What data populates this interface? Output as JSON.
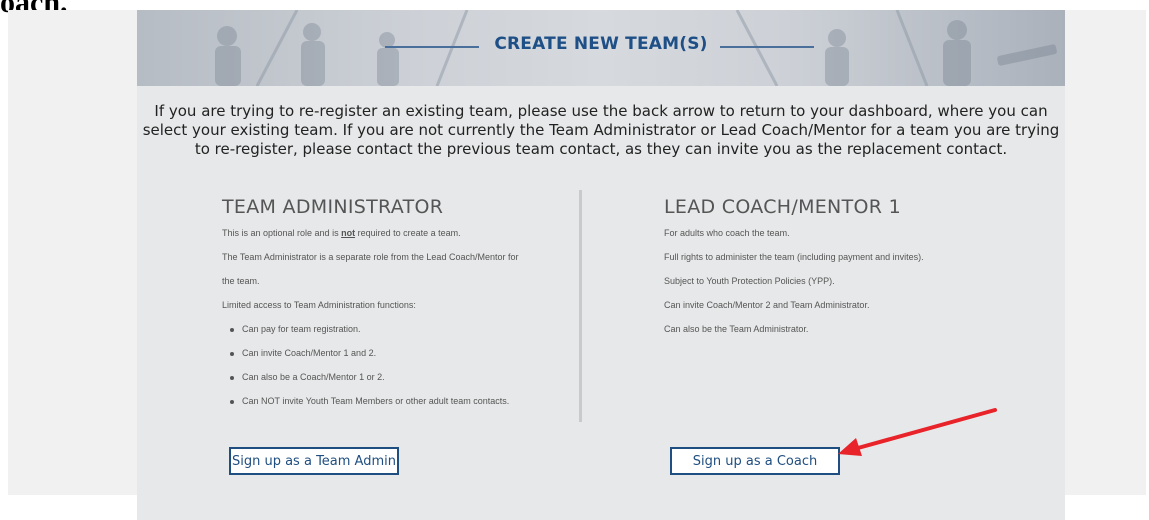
{
  "caption_fragment": "oach.",
  "banner": {
    "title": "CREATE NEW TEAM(S)"
  },
  "intro": {
    "lines": [
      "If you are trying to re-register an existing team, please use the back arrow to return to your dashboard, where you can",
      "select your existing team. If you are not currently the Team Administrator or Lead Coach/Mentor for a team you are trying",
      "to re-register, please contact the previous team contact, as they can invite you as the replacement contact."
    ]
  },
  "admin": {
    "heading": "TEAM ADMINISTRATOR",
    "optional_prefix": "This is an optional role and is ",
    "optional_emphasis": "not",
    "optional_suffix": " required to create a team.",
    "desc_line1": "The Team Administrator is a separate role from the Lead Coach/Mentor for",
    "desc_line2": "the team.",
    "access_intro": "Limited access to Team Administration functions:",
    "bullets": [
      "Can pay for team registration.",
      "Can invite Coach/Mentor 1 and 2.",
      "Can also be a Coach/Mentor 1 or 2.",
      "Can NOT invite Youth Team Members or other adult team contacts."
    ],
    "button_label": "Sign up as a Team Admin"
  },
  "coach": {
    "heading": "LEAD COACH/MENTOR 1",
    "lines": [
      "For adults who coach the team.",
      "Full rights to administer the team (including payment and invites).",
      "Subject to Youth Protection Policies (YPP).",
      "Can invite Coach/Mentor 2 and Team Administrator.",
      "Can also be the Team Administrator."
    ],
    "button_label": "Sign up as a Coach"
  },
  "colors": {
    "accent": "#1f4e80",
    "annotation_arrow": "#e8232a",
    "panel_bg": "#e7e8e9"
  },
  "annotation": {
    "icon": "red-arrow-pointer-icon"
  }
}
